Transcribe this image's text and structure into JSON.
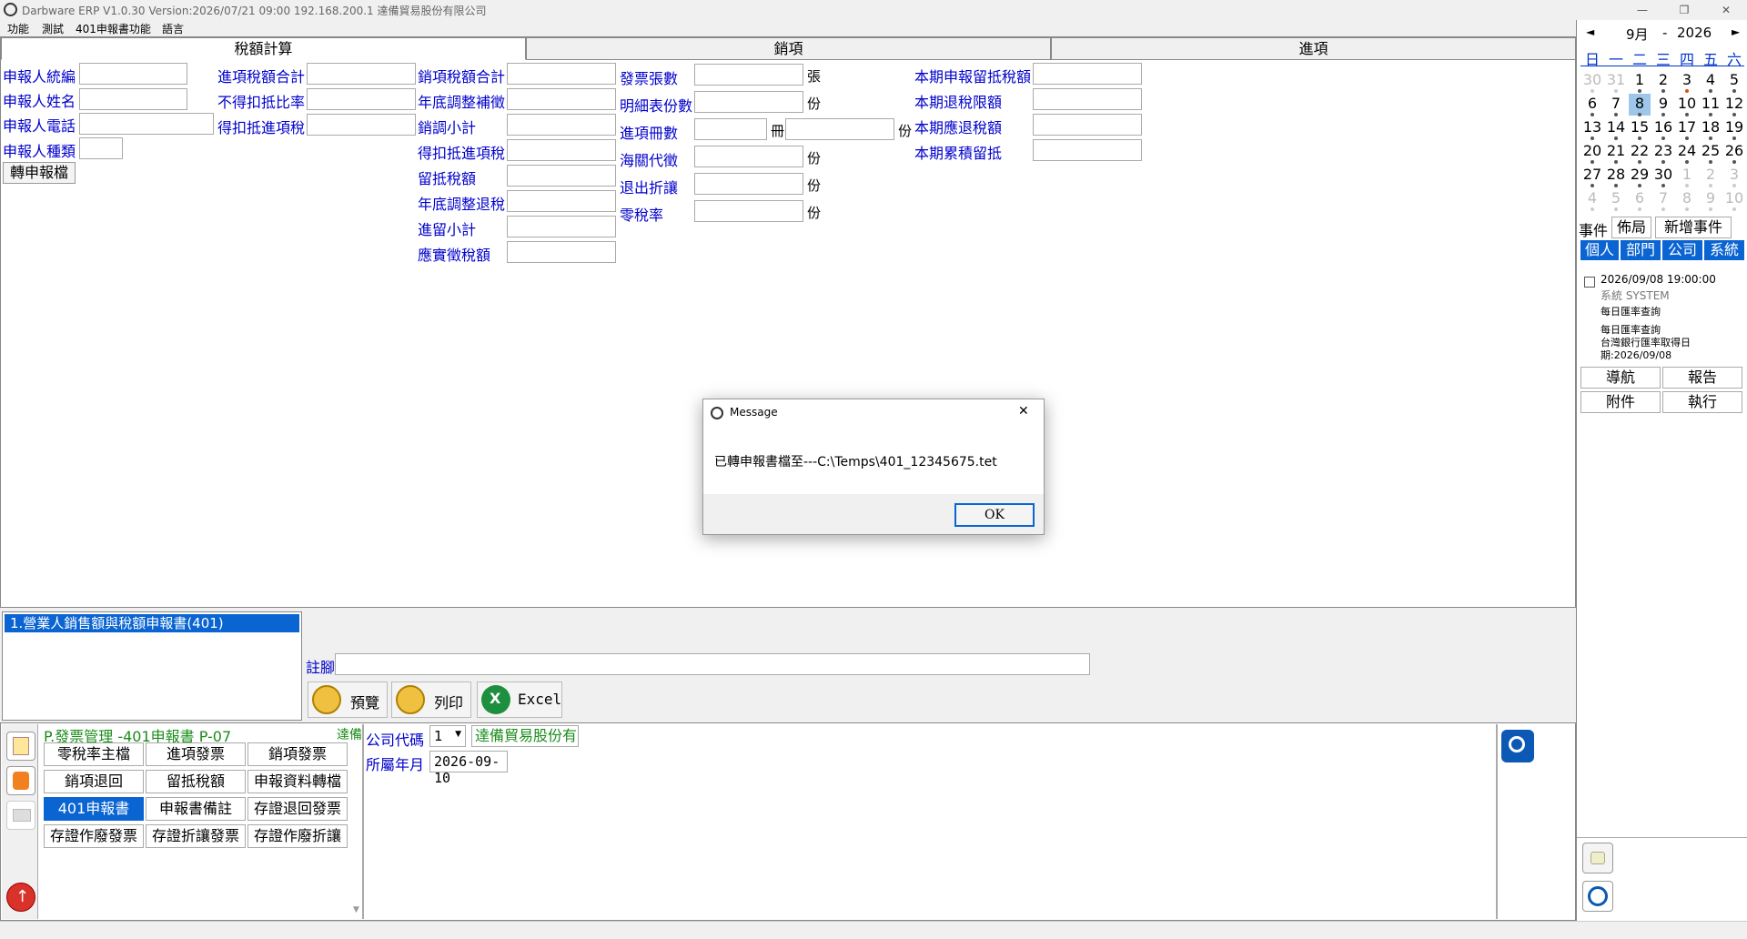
{
  "window": {
    "title": "Darbware ERP V1.0.30 Version:2026/07/21 09:00   192.168.200.1 達備貿易股份有限公司",
    "minimize": "—",
    "restore": "❐",
    "close": "✕"
  },
  "menu": [
    "功能",
    "測試",
    "401申報書功能",
    "語言"
  ],
  "tabs": [
    {
      "label": "稅額計算",
      "active": true
    },
    {
      "label": "銷項",
      "active": false
    },
    {
      "label": "進項",
      "active": false
    }
  ],
  "form": {
    "col1": [
      "申報人統編",
      "申報人姓名",
      "申報人電話",
      "申報人種類"
    ],
    "convert_button": "轉申報檔",
    "col2": [
      "進項稅額合計",
      "不得扣抵比率",
      "得扣抵進項稅"
    ],
    "col3": [
      "銷項稅額合計",
      "年底調整補徵",
      "銷調小計",
      "得扣抵進項稅",
      "留抵稅額",
      "年底調整退稅",
      "進留小計",
      "應實徵稅額"
    ],
    "col4": [
      "發票張數",
      "明細表份數",
      "進項冊數",
      "海關代徵",
      "退出折讓",
      "零稅率"
    ],
    "col4_units": [
      "張",
      "份",
      "冊",
      "份",
      "份",
      "份"
    ],
    "col5": [
      "本期申報留抵稅額",
      "本期退稅限額",
      "本期應退稅額",
      "本期累積留抵"
    ]
  },
  "report": {
    "list": [
      "1.營業人銷售額與稅額申報書(401)"
    ],
    "note_label": "註腳",
    "preview": "預覽",
    "print": "列印",
    "excel": "Excel"
  },
  "module": {
    "title": "P.發票管理 -401申報書  P-07",
    "company_short": "達備",
    "buttons": [
      [
        "零稅率主檔",
        "進項發票",
        "銷項發票"
      ],
      [
        "銷項退回",
        "留抵稅額",
        "申報資料轉檔"
      ],
      [
        "401申報書",
        "申報書備註",
        "存證退回發票"
      ],
      [
        "存證作廢發票",
        "存證折讓發票",
        "存證作廢折讓"
      ]
    ],
    "active_button": "401申報書",
    "company_code_label": "公司代碼",
    "company_code_value": "1",
    "company_name": "達備貿易股份有",
    "period_label": "所屬年月",
    "period_value": "2026-09-10"
  },
  "calendar": {
    "month": "9月",
    "sep": "-",
    "year": "2026",
    "prev": "◄",
    "next": "►",
    "weekdays": [
      "日",
      "一",
      "二",
      "三",
      "四",
      "五",
      "六"
    ],
    "weeks": [
      [
        "30",
        "31",
        "1",
        "2",
        "3",
        "4",
        "5"
      ],
      [
        "6",
        "7",
        "8",
        "9",
        "10",
        "11",
        "12"
      ],
      [
        "13",
        "14",
        "15",
        "16",
        "17",
        "18",
        "19"
      ],
      [
        "20",
        "21",
        "22",
        "23",
        "24",
        "25",
        "26"
      ],
      [
        "27",
        "28",
        "29",
        "30",
        "1",
        "2",
        "3"
      ],
      [
        "4",
        "5",
        "6",
        "7",
        "8",
        "9",
        "10"
      ]
    ],
    "selected": "8"
  },
  "events": {
    "tabs": [
      "事件",
      "佈局",
      "新增事件"
    ],
    "filters": [
      "個人",
      "部門",
      "公司",
      "系統"
    ],
    "item": {
      "datetime": "2026/09/08 19:00:00",
      "source": "系統  SYSTEM",
      "line1": "每日匯率查詢",
      "line2": "每日匯率查詢",
      "line3": "台灣銀行匯率取得日",
      "line4": "期:2026/09/08"
    },
    "actions": [
      "導航",
      "報告",
      "附件",
      "執行"
    ]
  },
  "dialog": {
    "title": "Message",
    "close": "✕",
    "message": "已轉申報書檔至---C:\\Temps\\401_12345675.tet",
    "ok": "OK"
  }
}
